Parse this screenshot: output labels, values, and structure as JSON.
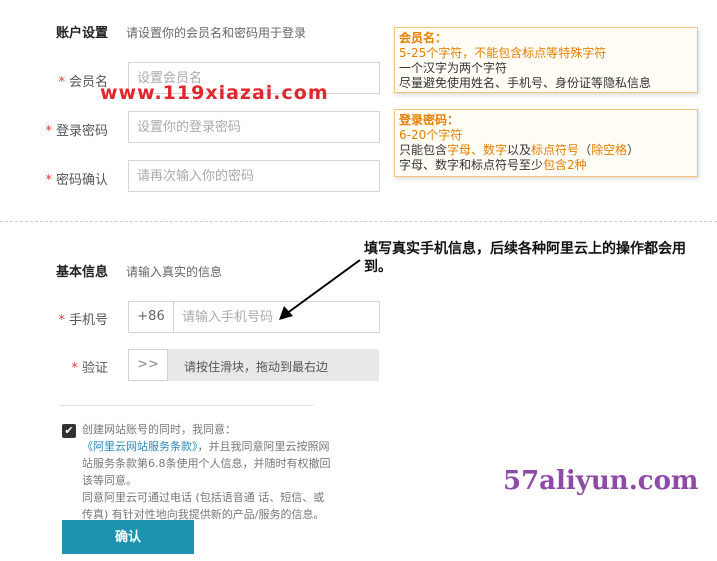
{
  "account": {
    "title": "账户设置",
    "hint": "请设置你的会员名和密码用于登录",
    "username": {
      "required": "*",
      "label": "会员名",
      "placeholder": "设置会员名"
    },
    "password": {
      "required": "*",
      "label": "登录密码",
      "placeholder": "设置你的登录密码"
    },
    "confirm": {
      "required": "*",
      "label": "密码确认",
      "placeholder": "请再次输入你的密码"
    }
  },
  "username_tip": {
    "title": "会员名：",
    "line1": "5-25个字符，不能包含标点等特殊字符",
    "line2": "一个汉字为两个字符",
    "line3": "尽量避免使用姓名、手机号、身份证等隐私信息"
  },
  "password_tip": {
    "title": "登录密码：",
    "line1": "6-20个字符",
    "line2_a": "只能包含",
    "line2_b": "字母、数字",
    "line2_c": "以及",
    "line2_d": "标点符号",
    "line2_e": "（",
    "line2_f": "除空格",
    "line2_g": "）",
    "line3_a": "字母、数字和标点符号至少",
    "line3_b": "包含2种"
  },
  "basic": {
    "title": "基本信息",
    "hint": "请输入真实的信息",
    "phone": {
      "required": "*",
      "label": "手机号",
      "prefix": "+86",
      "placeholder": "请输入手机号码"
    },
    "verify": {
      "required": "*",
      "label": "验证",
      "handle": ">>",
      "text": "请按住滑块，拖动到最右边"
    }
  },
  "agreement": {
    "checkmark": "✔",
    "line1": "创建网站账号的同时，我同意：",
    "link": "《阿里云网站服务条款》",
    "line2": "，并且我同意阿里云按照网站服务条款第6.8条使用个人信息，并随时有权撤回该等同意。",
    "line3": "同意阿里云可通过电话 (包括语音通 话、短信、或传真) 有针对性地向我提供新的产品/服务的信息。"
  },
  "confirm_button": "确认",
  "annotation": "填写真实手机信息，后续各种阿里云上的操作都会用到。",
  "watermark_top": "www.119xiazai.com",
  "watermark_bottom": "57aliyun.com",
  "colors": {
    "required": "#e4393c",
    "tip_accent": "#e67e00",
    "link": "#2a8ab8",
    "button": "#1e93b0",
    "watermark_top": "#e0272d",
    "watermark_bottom": "#8e4aa7"
  }
}
